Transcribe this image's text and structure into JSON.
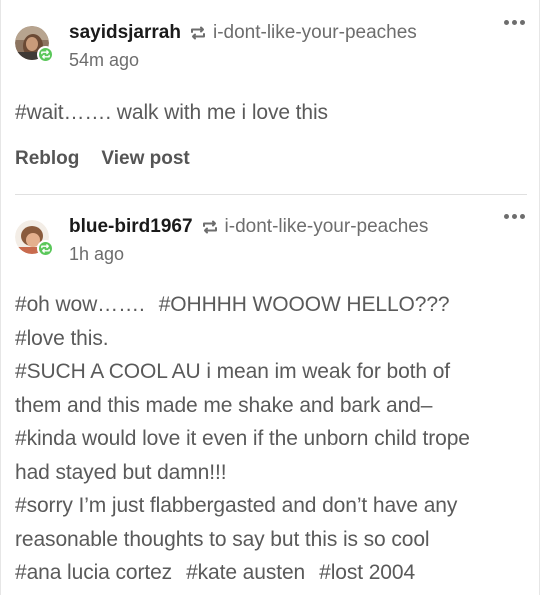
{
  "posts": [
    {
      "username": "sayidsjarrah",
      "source": "i-dont-like-your-peaches",
      "time": "54m ago",
      "lines": [
        [
          "#wait……. walk with me i love this"
        ]
      ],
      "actions": {
        "reblog": "Reblog",
        "view_post": "View post"
      }
    },
    {
      "username": "blue-bird1967",
      "source": "i-dont-like-your-peaches",
      "time": "1h ago",
      "lines": [
        [
          "#oh wow…….",
          "#OHHHH WOOOW HELLO???"
        ],
        [
          "#love this."
        ],
        [
          "#SUCH A COOL AU i mean im weak for both of"
        ],
        [
          "them and this made me shake and bark and–"
        ],
        [
          "#kinda would love it even if the unborn child trope"
        ],
        [
          "had stayed but damn!!!"
        ],
        [
          "#sorry I’m just flabbergasted and don’t have any"
        ],
        [
          "reasonable thoughts to say but this is so cool"
        ],
        [
          "#ana lucia cortez",
          "#kate austen",
          "#lost 2004"
        ]
      ]
    }
  ],
  "colors": {
    "badge": "#5ac75a",
    "muted": "#6d6d6d",
    "text": "#5a5a5a"
  },
  "icons": {
    "reblog": "reblog-icon",
    "more": "more-options-icon",
    "badge": "reblog-badge-icon"
  }
}
